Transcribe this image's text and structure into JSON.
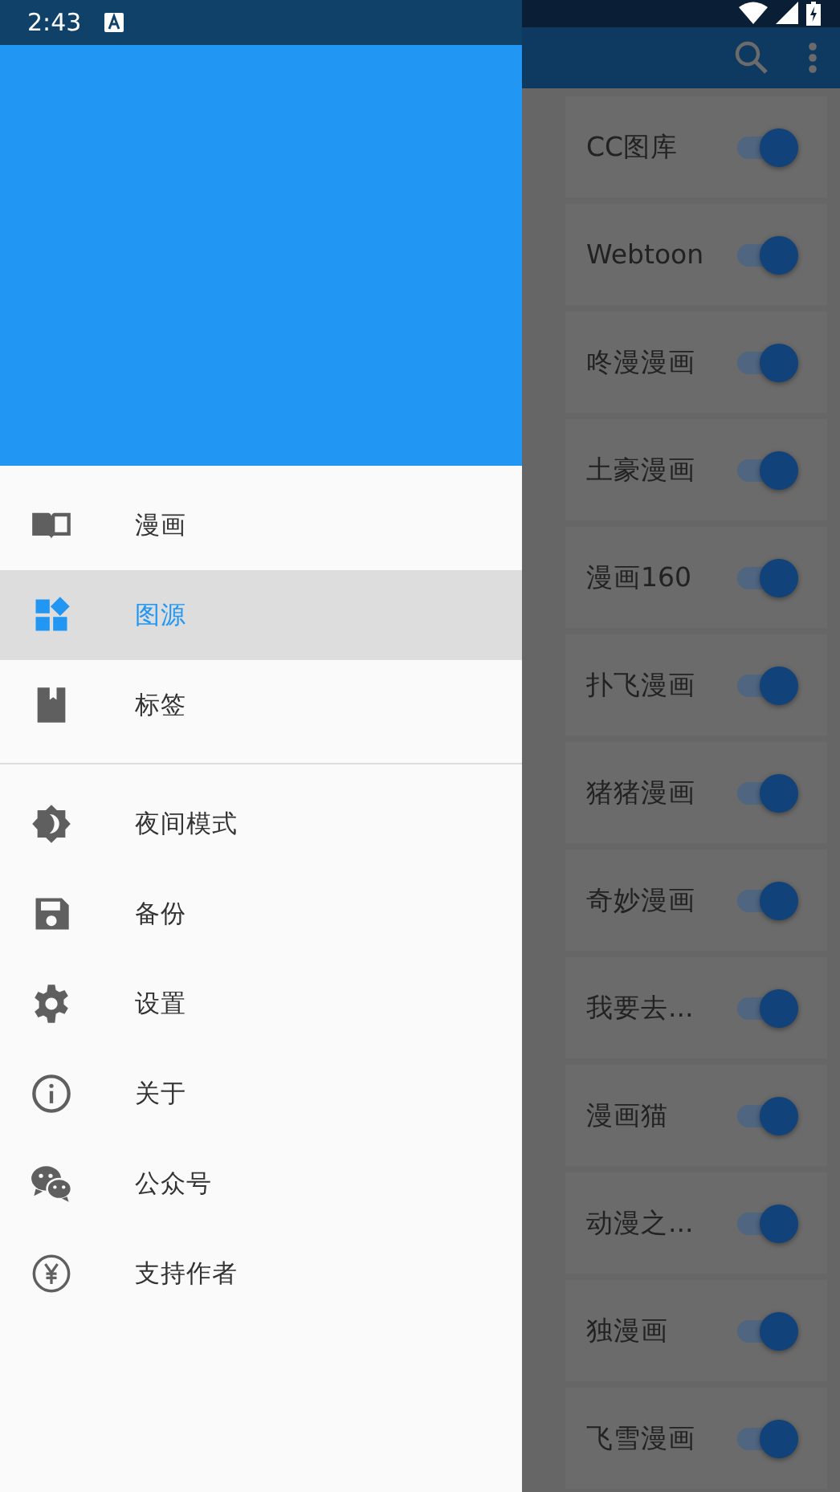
{
  "status_bar": {
    "time": "2:43"
  },
  "drawer": {
    "groups": [
      {
        "items": [
          {
            "label": "漫画",
            "kind": "book",
            "selected": false
          },
          {
            "label": "图源",
            "kind": "widgets",
            "selected": true
          },
          {
            "label": "标签",
            "kind": "bookmark",
            "selected": false
          }
        ]
      },
      {
        "items": [
          {
            "label": "夜间模式",
            "kind": "night",
            "selected": false
          },
          {
            "label": "备份",
            "kind": "save",
            "selected": false
          },
          {
            "label": "设置",
            "kind": "settings",
            "selected": false
          },
          {
            "label": "关于",
            "kind": "info",
            "selected": false
          },
          {
            "label": "公众号",
            "kind": "wechat",
            "selected": false
          },
          {
            "label": "支持作者",
            "kind": "yen",
            "selected": false
          }
        ]
      }
    ]
  },
  "sources": [
    {
      "name": "CC图库",
      "on": true
    },
    {
      "name": "Webtoon",
      "on": true
    },
    {
      "name": "咚漫漫画",
      "on": true
    },
    {
      "name": "土豪漫画",
      "on": true
    },
    {
      "name": "漫画160",
      "on": true
    },
    {
      "name": "扑飞漫画",
      "on": true
    },
    {
      "name": "猪猪漫画",
      "on": true
    },
    {
      "name": "奇妙漫画",
      "on": true
    },
    {
      "name": "我要去...",
      "on": true
    },
    {
      "name": "漫画猫",
      "on": true
    },
    {
      "name": "动漫之...",
      "on": true
    },
    {
      "name": "独漫画",
      "on": true
    },
    {
      "name": "飞雪漫画",
      "on": true
    }
  ]
}
